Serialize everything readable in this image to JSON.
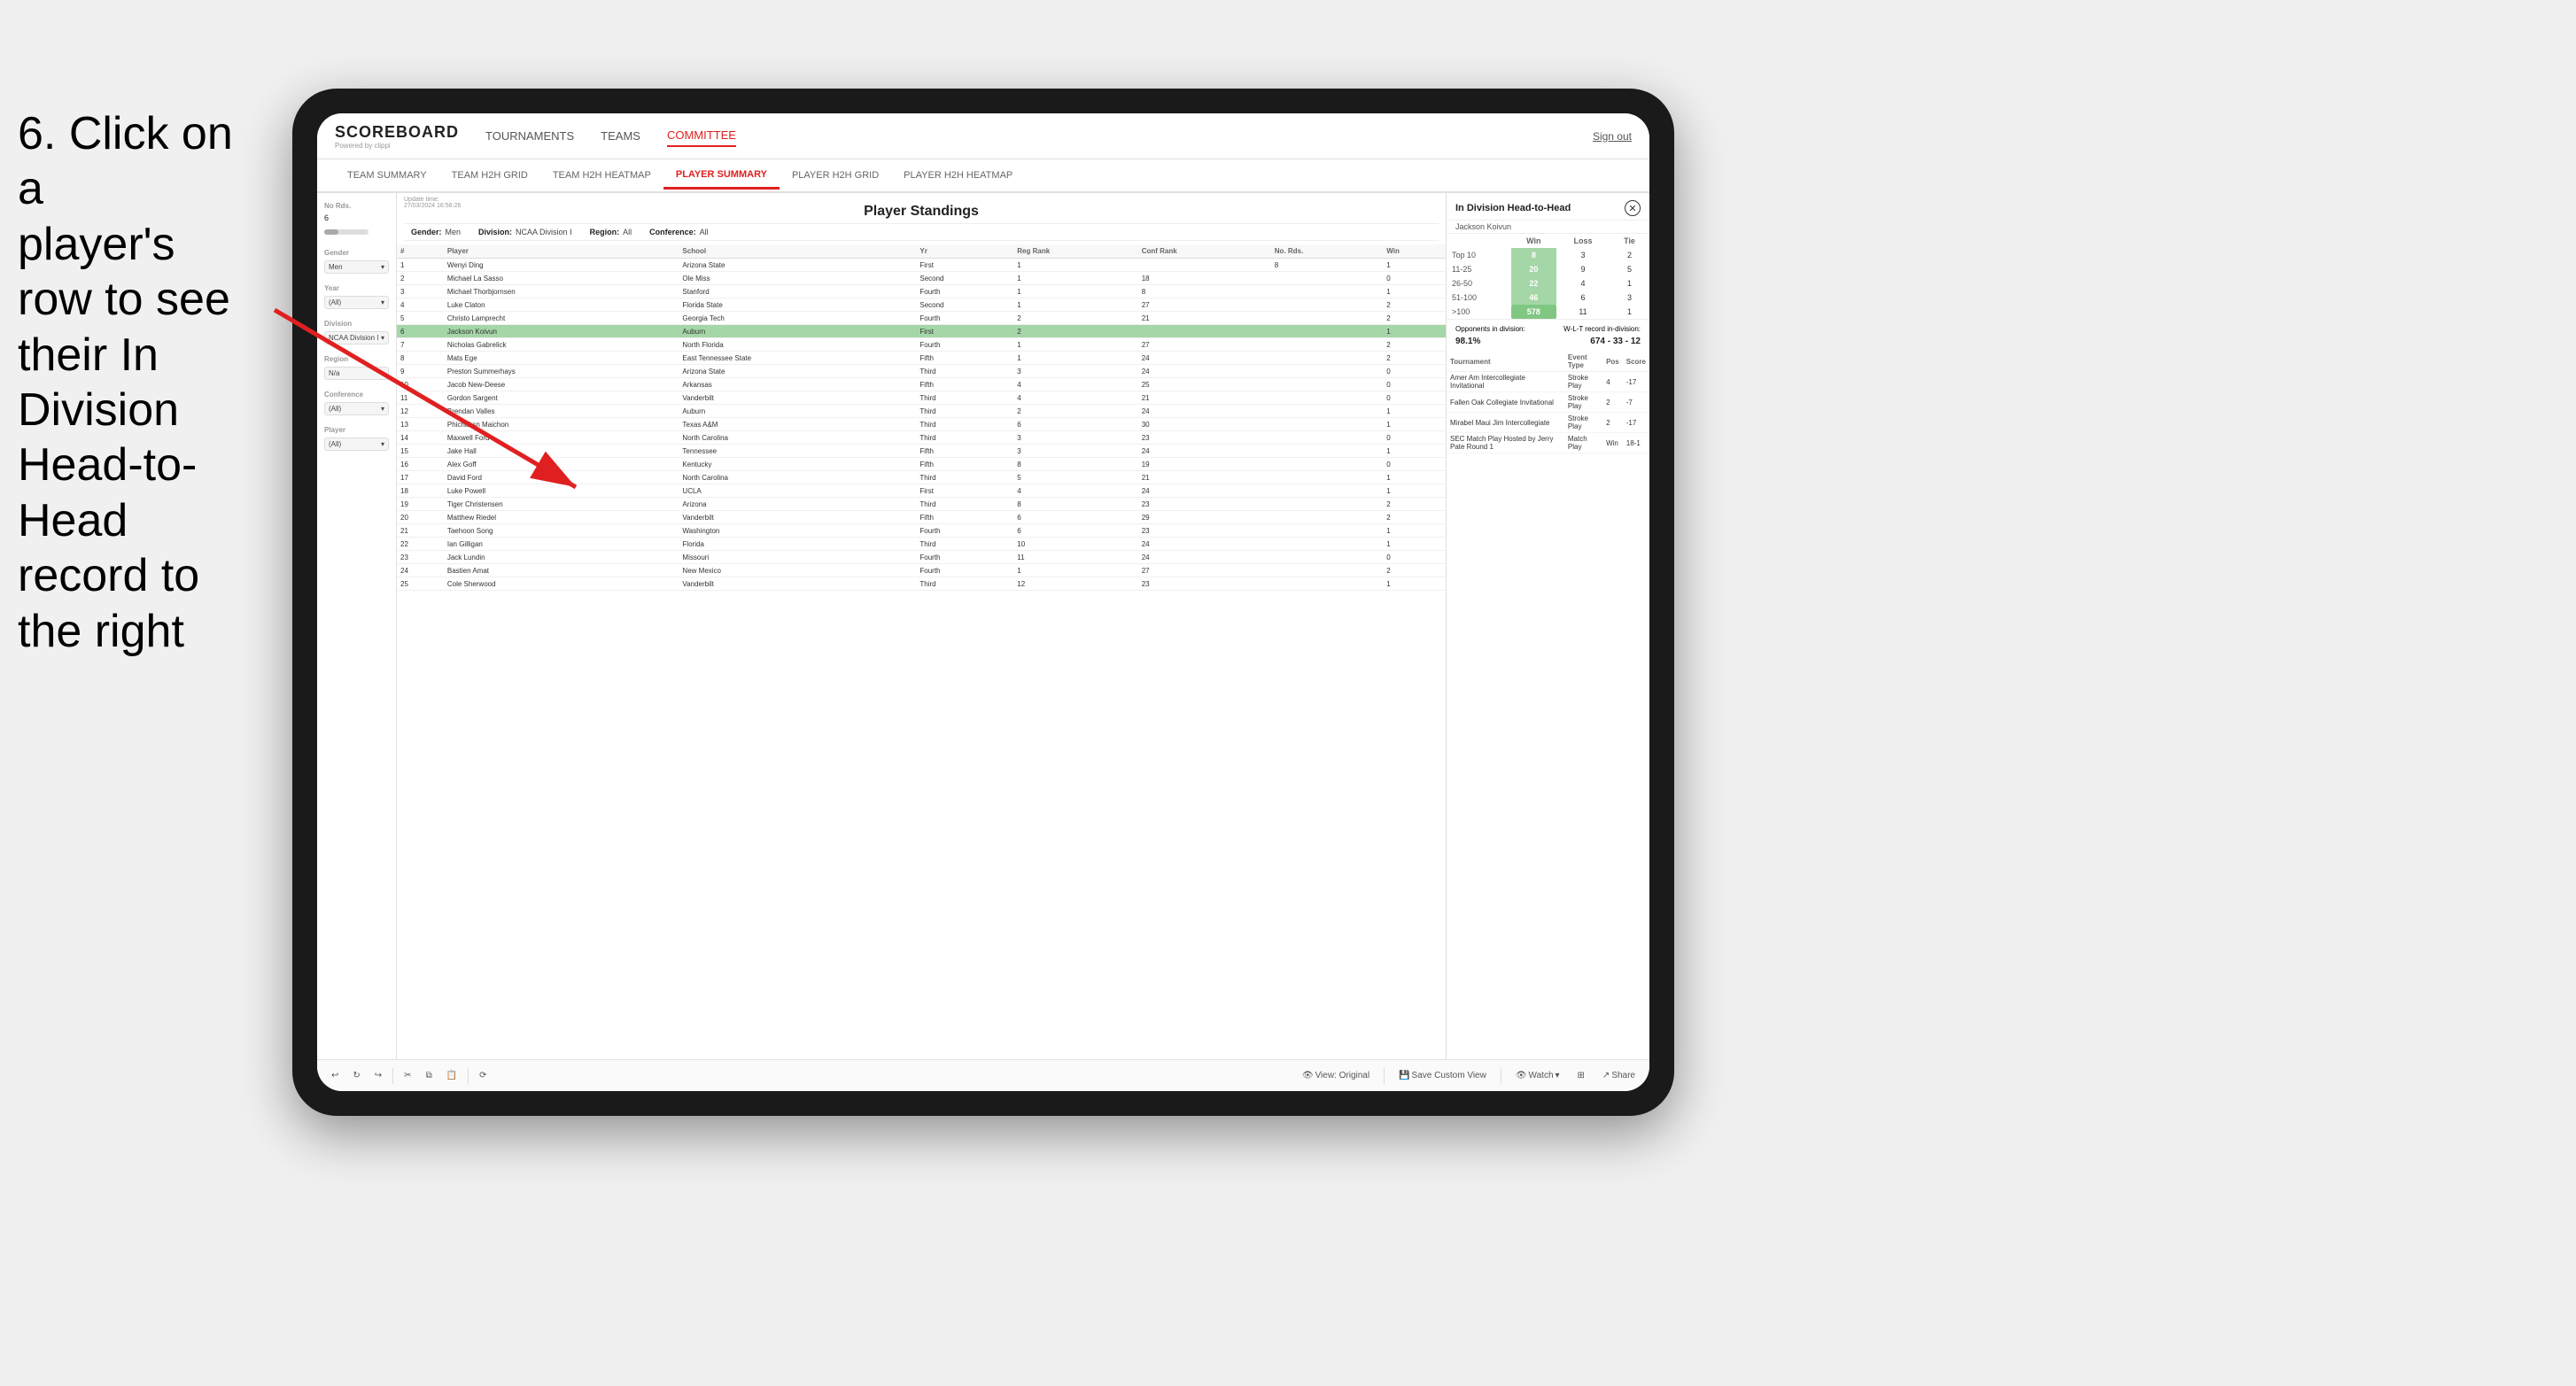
{
  "instruction": {
    "line1": "6. Click on a",
    "line2": "player's row to see",
    "line3": "their In Division",
    "line4": "Head-to-Head",
    "line5": "record to the right"
  },
  "app": {
    "logo": "SCOREBOARD",
    "logo_sub": "Powered by clippi",
    "nav_items": [
      "TOURNAMENTS",
      "TEAMS",
      "COMMITTEE"
    ],
    "sign_out": "Sign out",
    "sub_nav": [
      "TEAM SUMMARY",
      "TEAM H2H GRID",
      "TEAM H2H HEATMAP",
      "PLAYER SUMMARY",
      "PLAYER H2H GRID",
      "PLAYER H2H HEATMAP"
    ]
  },
  "sidebar": {
    "no_rds_label": "No Rds.",
    "no_rds_value": "6",
    "gender_label": "Gender",
    "gender_value": "Men",
    "year_label": "Year",
    "year_value": "(All)",
    "division_label": "Division",
    "division_value": "NCAA Division I",
    "region_label": "Region",
    "region_value": "N/a",
    "conference_label": "Conference",
    "conference_value": "(All)",
    "player_label": "Player",
    "player_value": "(All)"
  },
  "standings": {
    "title": "Player Standings",
    "update_label": "Update time:",
    "update_time": "27/03/2024 16:56:26",
    "gender_label": "Gender:",
    "gender_value": "Men",
    "division_label": "Division:",
    "division_value": "NCAA Division I",
    "region_label": "Region:",
    "region_value": "All",
    "conference_label": "Conference:",
    "conference_value": "All",
    "columns": [
      "#",
      "Player",
      "School",
      "Yr",
      "Reg Rank",
      "Conf Rank",
      "No. Rds.",
      "Win"
    ],
    "rows": [
      {
        "num": 1,
        "player": "Wenyi Ding",
        "school": "Arizona State",
        "yr": "First",
        "reg": 1,
        "conf": "",
        "rds": 8,
        "win": 1
      },
      {
        "num": 2,
        "player": "Michael La Sasso",
        "school": "Ole Miss",
        "yr": "Second",
        "reg": 1,
        "conf": 18,
        "rds": "",
        "win": 0
      },
      {
        "num": 3,
        "player": "Michael Thorbjornsen",
        "school": "Stanford",
        "yr": "Fourth",
        "reg": 1,
        "conf": 8,
        "rds": "",
        "win": 1
      },
      {
        "num": 4,
        "player": "Luke Claton",
        "school": "Florida State",
        "yr": "Second",
        "reg": 1,
        "conf": 27,
        "rds": "",
        "win": 2
      },
      {
        "num": 5,
        "player": "Christo Lamprecht",
        "school": "Georgia Tech",
        "yr": "Fourth",
        "reg": 2,
        "conf": 21,
        "rds": "",
        "win": 2
      },
      {
        "num": 6,
        "player": "Jackson Koivun",
        "school": "Auburn",
        "yr": "First",
        "reg": 2,
        "conf": "",
        "rds": "",
        "win": 1,
        "selected": true
      },
      {
        "num": 7,
        "player": "Nicholas Gabrelick",
        "school": "North Florida",
        "yr": "Fourth",
        "reg": 1,
        "conf": 27,
        "rds": "",
        "win": 2
      },
      {
        "num": 8,
        "player": "Mats Ege",
        "school": "East Tennessee State",
        "yr": "Fifth",
        "reg": 1,
        "conf": 24,
        "rds": "",
        "win": 2
      },
      {
        "num": 9,
        "player": "Preston Summerhays",
        "school": "Arizona State",
        "yr": "Third",
        "reg": 3,
        "conf": 24,
        "rds": "",
        "win": 0
      },
      {
        "num": 10,
        "player": "Jacob New-Deese",
        "school": "Arkansas",
        "yr": "Fifth",
        "reg": 4,
        "conf": 25,
        "rds": "",
        "win": 0
      },
      {
        "num": 11,
        "player": "Gordon Sargent",
        "school": "Vanderbilt",
        "yr": "Third",
        "reg": 4,
        "conf": 21,
        "rds": "",
        "win": 0
      },
      {
        "num": 12,
        "player": "Brendan Valles",
        "school": "Auburn",
        "yr": "Third",
        "reg": 2,
        "conf": 24,
        "rds": "",
        "win": 1
      },
      {
        "num": 13,
        "player": "Phichaksn Maichon",
        "school": "Texas A&M",
        "yr": "Third",
        "reg": 6,
        "conf": 30,
        "rds": "",
        "win": 1
      },
      {
        "num": 14,
        "player": "Maxwell Ford",
        "school": "North Carolina",
        "yr": "Third",
        "reg": 3,
        "conf": 23,
        "rds": "",
        "win": 0
      },
      {
        "num": 15,
        "player": "Jake Hall",
        "school": "Tennessee",
        "yr": "Fifth",
        "reg": 3,
        "conf": 24,
        "rds": "",
        "win": 1
      },
      {
        "num": 16,
        "player": "Alex Goff",
        "school": "Kentucky",
        "yr": "Fifth",
        "reg": 8,
        "conf": 19,
        "rds": "",
        "win": 0
      },
      {
        "num": 17,
        "player": "David Ford",
        "school": "North Carolina",
        "yr": "Third",
        "reg": 5,
        "conf": 21,
        "rds": "",
        "win": 1
      },
      {
        "num": 18,
        "player": "Luke Powell",
        "school": "UCLA",
        "yr": "First",
        "reg": 4,
        "conf": 24,
        "rds": "",
        "win": 1
      },
      {
        "num": 19,
        "player": "Tiger Christensen",
        "school": "Arizona",
        "yr": "Third",
        "reg": 8,
        "conf": 23,
        "rds": "",
        "win": 2
      },
      {
        "num": 20,
        "player": "Matthew Riedel",
        "school": "Vanderbilt",
        "yr": "Fifth",
        "reg": 6,
        "conf": 29,
        "rds": "",
        "win": 2
      },
      {
        "num": 21,
        "player": "Taehoon Song",
        "school": "Washington",
        "yr": "Fourth",
        "reg": 6,
        "conf": 23,
        "rds": "",
        "win": 1
      },
      {
        "num": 22,
        "player": "Ian Gilligan",
        "school": "Florida",
        "yr": "Third",
        "reg": 10,
        "conf": 24,
        "rds": "",
        "win": 1
      },
      {
        "num": 23,
        "player": "Jack Lundin",
        "school": "Missouri",
        "yr": "Fourth",
        "reg": 11,
        "conf": 24,
        "rds": "",
        "win": 0
      },
      {
        "num": 24,
        "player": "Bastien Amat",
        "school": "New Mexico",
        "yr": "Fourth",
        "reg": 1,
        "conf": 27,
        "rds": "",
        "win": 2
      },
      {
        "num": 25,
        "player": "Cole Sherwood",
        "school": "Vanderbilt",
        "yr": "Third",
        "reg": 12,
        "conf": 23,
        "rds": "",
        "win": 1
      }
    ]
  },
  "h2h": {
    "title": "In Division Head-to-Head",
    "player": "Jackson Koivun",
    "col_win": "Win",
    "col_loss": "Loss",
    "col_tie": "Tie",
    "ranges": [
      {
        "range": "Top 10",
        "win": 8,
        "loss": 3,
        "tie": 2
      },
      {
        "range": "11-25",
        "win": 20,
        "loss": 9,
        "tie": 5
      },
      {
        "range": "26-50",
        "win": 22,
        "loss": 4,
        "tie": 1
      },
      {
        "range": "51-100",
        "win": 46,
        "loss": 6,
        "tie": 3
      },
      {
        "range": ">100",
        "win": 578,
        "loss": 11,
        "tie": 1
      }
    ],
    "opponents_label": "Opponents in division:",
    "record_label": "W-L-T record in-division:",
    "opponents_pct": "98.1%",
    "record": "674 - 33 - 12",
    "tournament_columns": [
      "Tournament",
      "Event Type",
      "Pos",
      "Score"
    ],
    "tournaments": [
      {
        "name": "Amer Am Intercollegiate Invitational",
        "type": "Stroke Play",
        "pos": 4,
        "score": "-17"
      },
      {
        "name": "Fallen Oak Collegiate Invitational",
        "type": "Stroke Play",
        "pos": 2,
        "score": "-7"
      },
      {
        "name": "Mirabel Maui Jim Intercollegiate",
        "type": "Stroke Play",
        "pos": 2,
        "score": "-17"
      },
      {
        "name": "SEC Match Play Hosted by Jerry Pate Round 1",
        "type": "Match Play",
        "pos": "Win",
        "score": "18-1"
      }
    ]
  },
  "toolbar": {
    "view_original": "View: Original",
    "save_custom": "Save Custom View",
    "watch": "Watch",
    "share": "Share"
  }
}
